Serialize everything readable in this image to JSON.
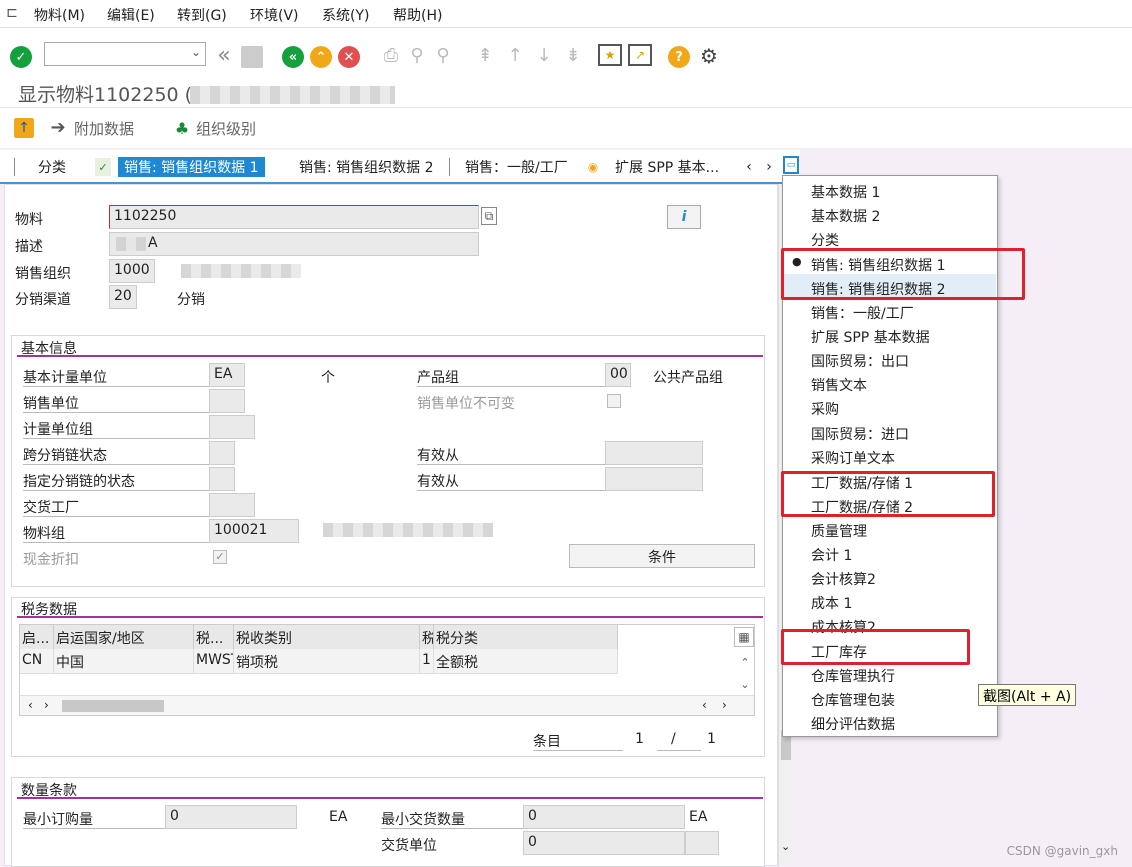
{
  "menu": [
    "物料(M)",
    "编辑(E)",
    "转到(G)",
    "环境(V)",
    "系统(Y)",
    "帮助(H)"
  ],
  "title": "显示物料1102250 (",
  "appbar": {
    "additional": "附加数据",
    "org_levels": "组织级别"
  },
  "tabs": [
    "分类",
    "销售: 销售组织数据 1",
    "销售: 销售组织数据 2",
    "销售：一般/工厂",
    "扩展 SPP 基本..."
  ],
  "header": {
    "material_label": "物料",
    "material_value": "1102250",
    "desc_label": "描述",
    "desc_value": "A",
    "salesorg_label": "销售组织",
    "salesorg_value": "1000",
    "channel_label": "分销渠道",
    "channel_value": "20",
    "channel_text": "分销"
  },
  "basic": {
    "title": "基本信息",
    "base_uom_label": "基本计量单位",
    "base_uom_value": "EA",
    "base_uom_text": "个",
    "prod_group_label": "产品组",
    "prod_group_value": "00",
    "prod_group_text": "公共产品组",
    "sales_unit_label": "销售单位",
    "sales_unit_fixed_label": "销售单位不可变",
    "uom_group_label": "计量单位组",
    "xchain_label": "跨分销链状态",
    "valid_from1": "有效从",
    "dchain_label": "指定分销链的状态",
    "valid_from2": "有效从",
    "plant_label": "交货工厂",
    "matgroup_label": "物料组",
    "matgroup_value": "100021",
    "cash_disc_label": "现金折扣",
    "conditions_button": "条件"
  },
  "tax": {
    "title": "税务数据",
    "columns": [
      "启...",
      "启运国家/地区",
      "税...",
      "税收类别",
      "税",
      "税分类"
    ],
    "rows": [
      [
        "CN",
        "中国",
        "MWST",
        "销项税",
        "1",
        "全额税"
      ]
    ],
    "entry_label": "条目",
    "entry_current": "1",
    "entry_sep": "/",
    "entry_total": "1"
  },
  "qty": {
    "title": "数量条款",
    "min_order_label": "最小订购量",
    "min_order_value": "0",
    "min_order_unit": "EA",
    "min_deliv_label": "最小交货数量",
    "min_deliv_value": "0",
    "min_deliv_unit": "EA",
    "deliv_unit_label": "交货单位",
    "deliv_unit_value": "0"
  },
  "dropdown": [
    "基本数据 1",
    "基本数据 2",
    "分类",
    "销售: 销售组织数据 1",
    "销售: 销售组织数据 2",
    "销售：一般/工厂",
    "扩展 SPP 基本数据",
    "国际贸易：出口",
    "销售文本",
    "采购",
    "国际贸易：进口",
    "采购订单文本",
    "工厂数据/存储 1",
    "工厂数据/存储 2",
    "质量管理",
    "会计 1",
    "会计核算2",
    "成本 1",
    "成本核算2",
    "工厂库存",
    "仓库管理执行",
    "仓库管理包装",
    "细分评估数据"
  ],
  "dropdown_bullet": "●",
  "tooltip": "截图(Alt + A)",
  "watermark": "CSDN @gavin_gxh",
  "colors": {
    "accent": "#1e88d2",
    "section_line": "#a0339e",
    "highlight_box": "#e0202a"
  }
}
